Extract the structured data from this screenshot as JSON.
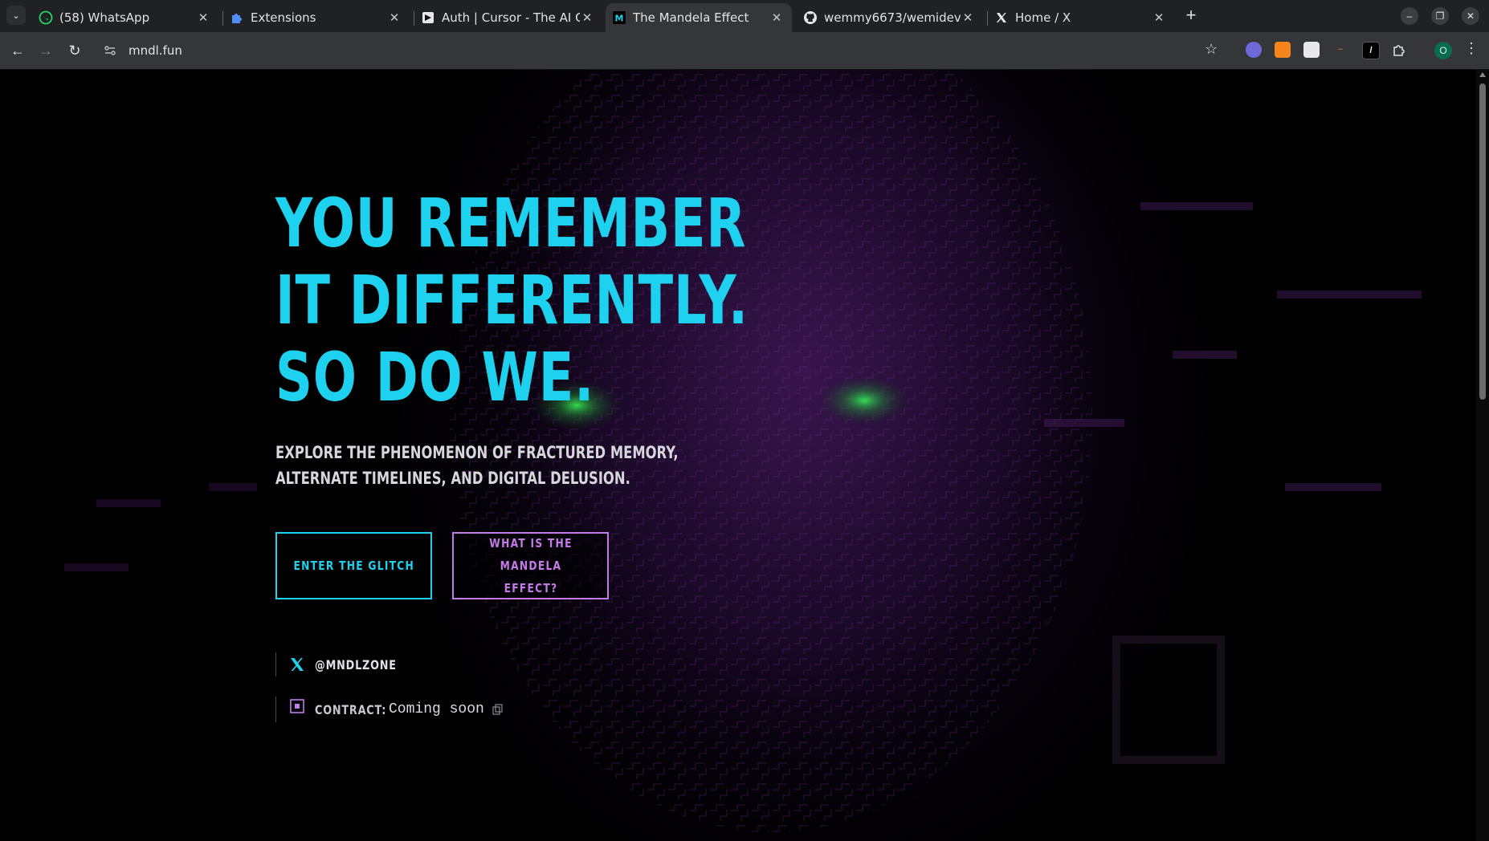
{
  "browser": {
    "tabs": [
      {
        "title": "(58) WhatsApp",
        "favicon": "whatsapp-icon",
        "active": false
      },
      {
        "title": "Extensions",
        "favicon": "puzzle-icon",
        "active": false
      },
      {
        "title": "Auth | Cursor - The AI Code Editor",
        "favicon": "cursor-icon",
        "active": false
      },
      {
        "title": "The Mandela Effect",
        "favicon": "m-icon",
        "active": true
      },
      {
        "title": "wemmy6673/wemidev",
        "favicon": "github-icon",
        "active": false
      },
      {
        "title": "Home / X",
        "favicon": "x-icon",
        "active": false
      }
    ],
    "tab_close_glyph": "✕",
    "new_tab_glyph": "+",
    "url": "mndl.fun",
    "profile_initial": "O",
    "accent_color": "#1ed1ee"
  },
  "hero": {
    "line1": "YOU REMEMBER",
    "line2": "IT DIFFERENTLY.",
    "line3": "SO DO WE.",
    "subtitle": "Explore the phenomenon of fractured memory, alternate timelines, and digital delusion."
  },
  "buttons": {
    "enter": "ENTER THE GLITCH",
    "what": "WHAT IS THE MANDELA EFFECT?"
  },
  "social": {
    "handle": "@MNDLZONE"
  },
  "contract": {
    "label": "CONTRACT:",
    "value": "Coming soon"
  },
  "colors": {
    "cyan": "#1ed1ee",
    "purple": "#c27be8",
    "eyes": "#2bd94a"
  }
}
